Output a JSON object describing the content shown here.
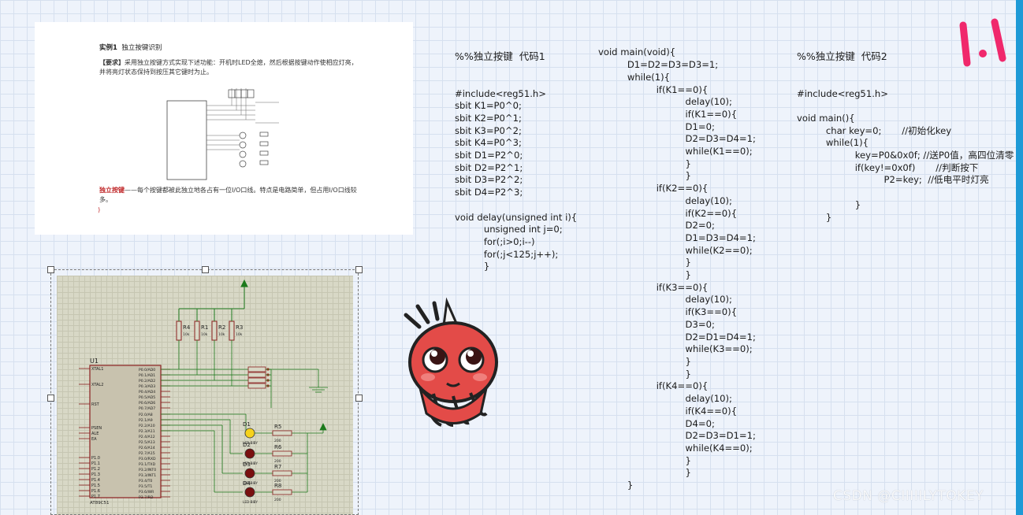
{
  "doc": {
    "title_bold": "实例1",
    "title_text": "独立按键识别",
    "req_label": "【要求】",
    "req_text": "采用独立按键方式实现下述功能：开机时LED全熄，然后根据按键动作使相应灯亮，并将亮灯状态保持到按压其它键时为止。",
    "desc_label": "独立按键",
    "desc_text": "——每个按键都被此独立地各占有一位I/O口线。特点是电路简单，但占用I/O口线较多。",
    "paren": ")"
  },
  "code1": {
    "heading": "%%独立按键  代码1",
    "lines": [
      "#include<reg51.h>",
      "sbit K1=P0^0;",
      "sbit K2=P0^1;",
      "sbit K3=P0^2;",
      "sbit K4=P0^3;",
      "sbit D1=P2^0;",
      "sbit D2=P2^1;",
      "sbit D3=P2^2;",
      "sbit D4=P2^3;",
      "",
      "void delay(unsigned int i){",
      "          unsigned int j=0;",
      "          for(;i>0;i--)",
      "          for(;j<125;j++);",
      "          }"
    ]
  },
  "code2": {
    "lines": [
      "void main(void){",
      "          D1=D2=D3=D3=1;",
      "          while(1){",
      "                    if(K1==0){",
      "                              delay(10);",
      "                              if(K1==0){",
      "                              D1=0;",
      "                              D2=D3=D4=1;",
      "                              while(K1==0);",
      "                              }",
      "                              }",
      "                    if(K2==0){",
      "                              delay(10);",
      "                              if(K2==0){",
      "                              D2=0;",
      "                              D1=D3=D4=1;",
      "                              while(K2==0);",
      "                              }",
      "                              }",
      "                    if(K3==0){",
      "                              delay(10);",
      "                              if(K3==0){",
      "                              D3=0;",
      "                              D2=D1=D4=1;",
      "                              while(K3==0);",
      "                              }",
      "                              }",
      "                    if(K4==0){",
      "                              delay(10);",
      "                              if(K4==0){",
      "                              D4=0;",
      "                              D2=D3=D1=1;",
      "                              while(K4==0);",
      "                              }",
      "                              }",
      "          }"
    ]
  },
  "code3": {
    "heading": "%%独立按键  代码2",
    "lines": [
      "#include<reg51.h>",
      "",
      "void main(){",
      "          char key=0;       //初始化key",
      "          while(1){",
      "                    key=P0&0x0f; //送P0值，高四位清零",
      "                    if(key!=0x0f)       //判断按下",
      "                              P2=key;  //低电平时灯亮",
      "",
      "                    }",
      "          }"
    ]
  },
  "schematic": {
    "chip_name": "U1",
    "chip_part": "AT89C51",
    "left_pins": [
      "XTAL1",
      "XTAL2",
      "RST",
      "PSEN",
      "ALE",
      "EA",
      "P1.0",
      "P1.1",
      "P1.2",
      "P1.3",
      "P1.4",
      "P1.5",
      "P1.6",
      "P1.7"
    ],
    "port0_pins": [
      "P0.0/AD0",
      "P0.1/AD1",
      "P0.2/AD2",
      "P0.3/AD3",
      "P0.4/AD4",
      "P0.5/AD5",
      "P0.6/AD6",
      "P0.7/AD7"
    ],
    "port2_pins": [
      "P2.0/A8",
      "P2.1/A9",
      "P2.2/A10",
      "P2.3/A11",
      "P2.4/A12",
      "P2.5/A13",
      "P2.6/A14",
      "P2.7/A15"
    ],
    "port3_pins": [
      "P3.0/RXD",
      "P3.1/TXD",
      "P3.2/INT0",
      "P3.3/INT1",
      "P3.4/T0",
      "P3.5/T1",
      "P3.6/WR",
      "P3.7/RD"
    ],
    "resistors_top": [
      "R4",
      "R1",
      "R2",
      "R3"
    ],
    "resistor_value": "10k",
    "leds": [
      "D1",
      "D2",
      "D3",
      "D4"
    ],
    "led_part": "LED-BIBY",
    "resistors_led": [
      "R5",
      "R6",
      "R7",
      "R8"
    ],
    "led_res_value": "200"
  },
  "watermark": "CSDN @CIIIIILYTOKEY",
  "colors": {
    "accent_bar": "#1e9ad6",
    "mascot_red": "#e34b48",
    "doodle_pink": "#f0286c"
  }
}
